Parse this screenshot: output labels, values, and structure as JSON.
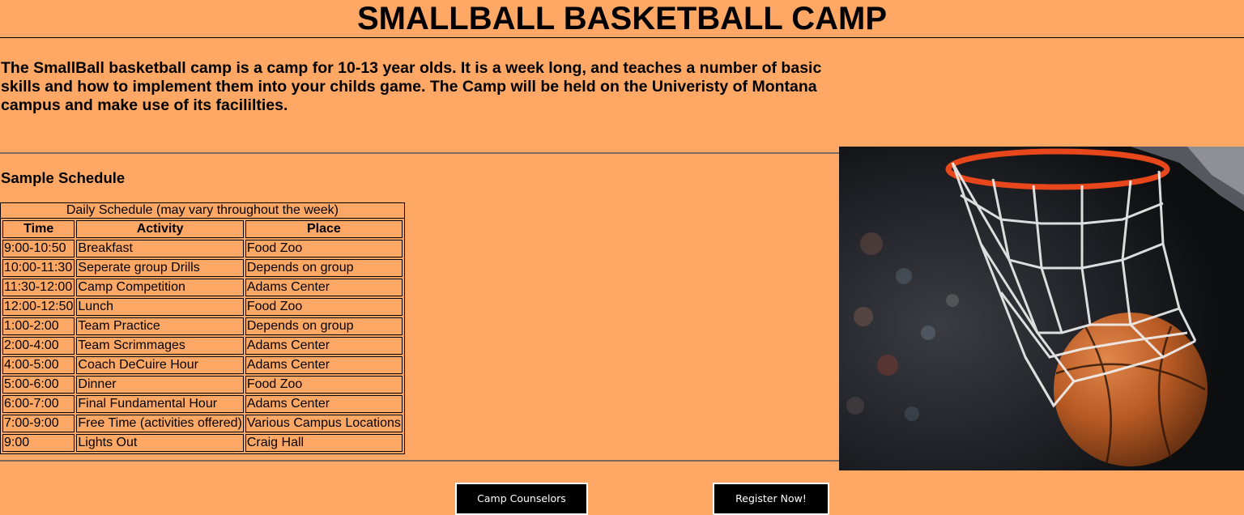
{
  "header": {
    "title": "SMALLBALL BASKETBALL CAMP"
  },
  "intro": {
    "text": "The SmallBall basketball camp is a camp for 10-13 year olds. It is a week long, and teaches a number of basic skills and how to implement them into your childs game. The Camp will be held on the Univeristy of Montana campus and make use of its facililties."
  },
  "schedule": {
    "heading": "Sample Schedule",
    "caption": "Daily Schedule (may vary throughout the week)",
    "columns": [
      "Time",
      "Activity",
      "Place"
    ],
    "rows": [
      [
        "9:00-10:50",
        "Breakfast",
        "Food Zoo"
      ],
      [
        "10:00-11:30",
        "Seperate group Drills",
        "Depends on group"
      ],
      [
        "11:30-12:00",
        "Camp Competition",
        "Adams Center"
      ],
      [
        "12:00-12:50",
        "Lunch",
        "Food Zoo"
      ],
      [
        "1:00-2:00",
        "Team Practice",
        "Depends on group"
      ],
      [
        "2:00-4:00",
        "Team Scrimmages",
        "Adams Center"
      ],
      [
        "4:00-5:00",
        "Coach DeCuire Hour",
        "Adams Center"
      ],
      [
        "5:00-6:00",
        "Dinner",
        "Food Zoo"
      ],
      [
        "6:00-7:00",
        "Final Fundamental Hour",
        "Adams Center"
      ],
      [
        "7:00-9:00",
        "Free Time (activities offered)",
        "Various Campus Locations"
      ],
      [
        "9:00",
        "Lights Out",
        "Craig Hall"
      ]
    ]
  },
  "nav": {
    "counselors_label": "Camp Counselors",
    "register_label": "Register Now!"
  },
  "colors": {
    "background": "#ffa866",
    "button_bg": "#000000",
    "button_text": "#ffffff"
  },
  "photo": {
    "icon": "basketball-hoop-photo"
  }
}
